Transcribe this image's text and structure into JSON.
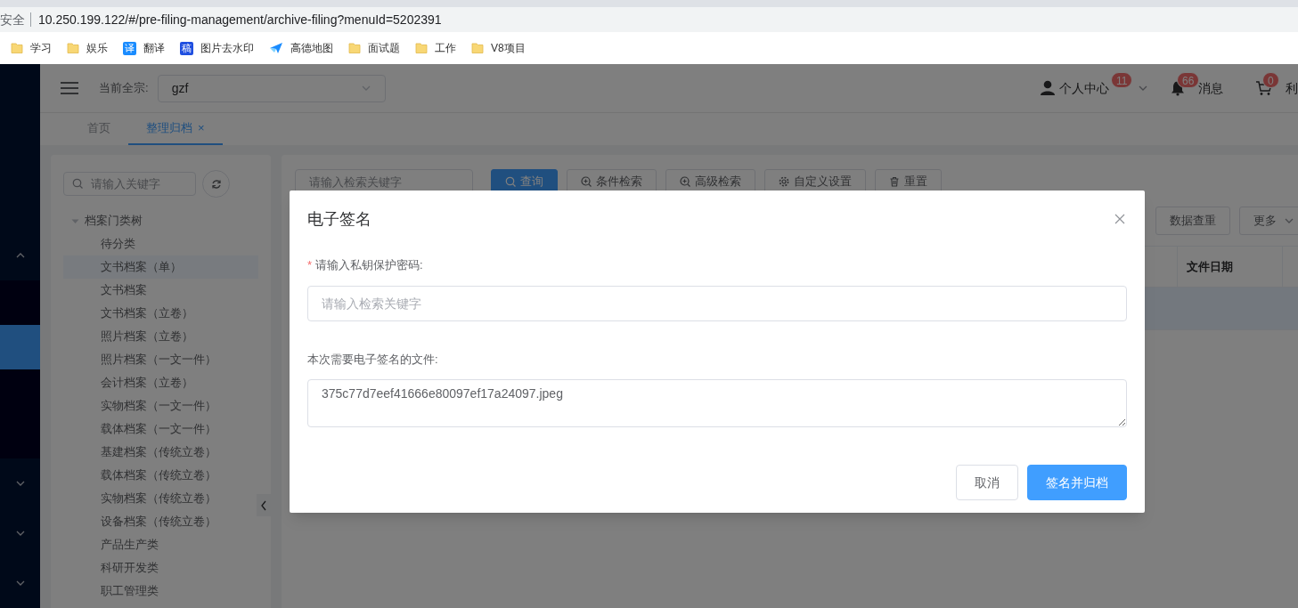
{
  "browser": {
    "security": "安全",
    "url": "10.250.199.122/#/pre-filing-management/archive-filing?menuId=5202391",
    "bookmarks": [
      {
        "label": "学习",
        "kind": "folder"
      },
      {
        "label": "娱乐",
        "kind": "folder"
      },
      {
        "label": "翻译",
        "kind": "badge",
        "icon_text": "译",
        "color": "#1a8cff"
      },
      {
        "label": "图片去水印",
        "kind": "badge",
        "icon_text": "稿",
        "color": "#1f4fe0"
      },
      {
        "label": "高德地图",
        "kind": "plane"
      },
      {
        "label": "面试题",
        "kind": "folder"
      },
      {
        "label": "工作",
        "kind": "folder"
      },
      {
        "label": "V8项目",
        "kind": "folder"
      }
    ]
  },
  "sidebar": {
    "items": [
      {
        "kind": "group",
        "expanded": true
      },
      {
        "kind": "item",
        "selected": false
      },
      {
        "kind": "item",
        "selected": true
      },
      {
        "kind": "item",
        "selected": false
      },
      {
        "kind": "item",
        "selected": false
      },
      {
        "kind": "group",
        "expanded": false
      },
      {
        "kind": "group",
        "expanded": false
      },
      {
        "kind": "group",
        "expanded": false
      }
    ]
  },
  "header": {
    "fonds_label": "当前全宗:",
    "fonds_value": "gzf",
    "actions": [
      {
        "kind": "user",
        "label": "个人中心",
        "badge": "11",
        "dropdown": true
      },
      {
        "kind": "bell",
        "label": "消息",
        "badge": "66",
        "dropdown": false
      },
      {
        "kind": "cart",
        "label": "利",
        "badge": "0",
        "dropdown": false
      }
    ]
  },
  "tabs": [
    {
      "label": "首页",
      "selected": false
    },
    {
      "label": "整理归档",
      "selected": true,
      "close": "×"
    }
  ],
  "tree": {
    "search_placeholder": "请输入关键字",
    "root": {
      "label": "档案门类树",
      "expanded": true,
      "children": [
        {
          "label": "待分类",
          "selected": false
        },
        {
          "label": "文书档案（单）",
          "selected": true
        },
        {
          "label": "文书档案",
          "selected": false
        },
        {
          "label": "文书档案（立卷）",
          "selected": false
        },
        {
          "label": "照片档案（立卷）",
          "selected": false
        },
        {
          "label": "照片档案（一文一件）",
          "selected": false
        },
        {
          "label": "会计档案（立卷）",
          "selected": false
        },
        {
          "label": "实物档案（一文一件）",
          "selected": false
        },
        {
          "label": "载体档案（一文一件）",
          "selected": false
        },
        {
          "label": "基建档案（传统立卷）",
          "selected": false
        },
        {
          "label": "载体档案（传统立卷）",
          "selected": false
        },
        {
          "label": "实物档案（传统立卷）",
          "selected": false
        },
        {
          "label": "设备档案（传统立卷）",
          "selected": false
        },
        {
          "label": "产品生产类",
          "selected": false
        },
        {
          "label": "科研开发类",
          "selected": false
        },
        {
          "label": "职工管理类",
          "selected": false
        }
      ]
    }
  },
  "toolbar": {
    "search_placeholder": "请输入检索关键字",
    "buttons": [
      {
        "label": "查询",
        "kind": "primary"
      },
      {
        "label": "条件检索",
        "kind": "default"
      },
      {
        "label": "高级检索",
        "kind": "default"
      },
      {
        "label": "自定义设置",
        "kind": "default"
      },
      {
        "label": "重置",
        "kind": "default"
      }
    ],
    "more_buttons": [
      {
        "label": "数据查重",
        "dropdown": false
      },
      {
        "label": "更多",
        "dropdown": true
      }
    ]
  },
  "table": {
    "columns": [
      "文件日期"
    ],
    "rows": [
      {
        "selected": true
      }
    ]
  },
  "dialog": {
    "title": "电子签名",
    "fields": [
      {
        "kind": "input",
        "required_mark": "*",
        "label": "请输入私钥保护密码:",
        "placeholder": "请输入检索关键字"
      },
      {
        "kind": "textarea",
        "label": "本次需要电子签名的文件:",
        "value": "375c77d7eef41666e80097ef17a24097.jpeg"
      }
    ],
    "buttons": [
      {
        "label": "取消",
        "kind": "default"
      },
      {
        "label": "签名并归档",
        "kind": "primary"
      }
    ]
  }
}
